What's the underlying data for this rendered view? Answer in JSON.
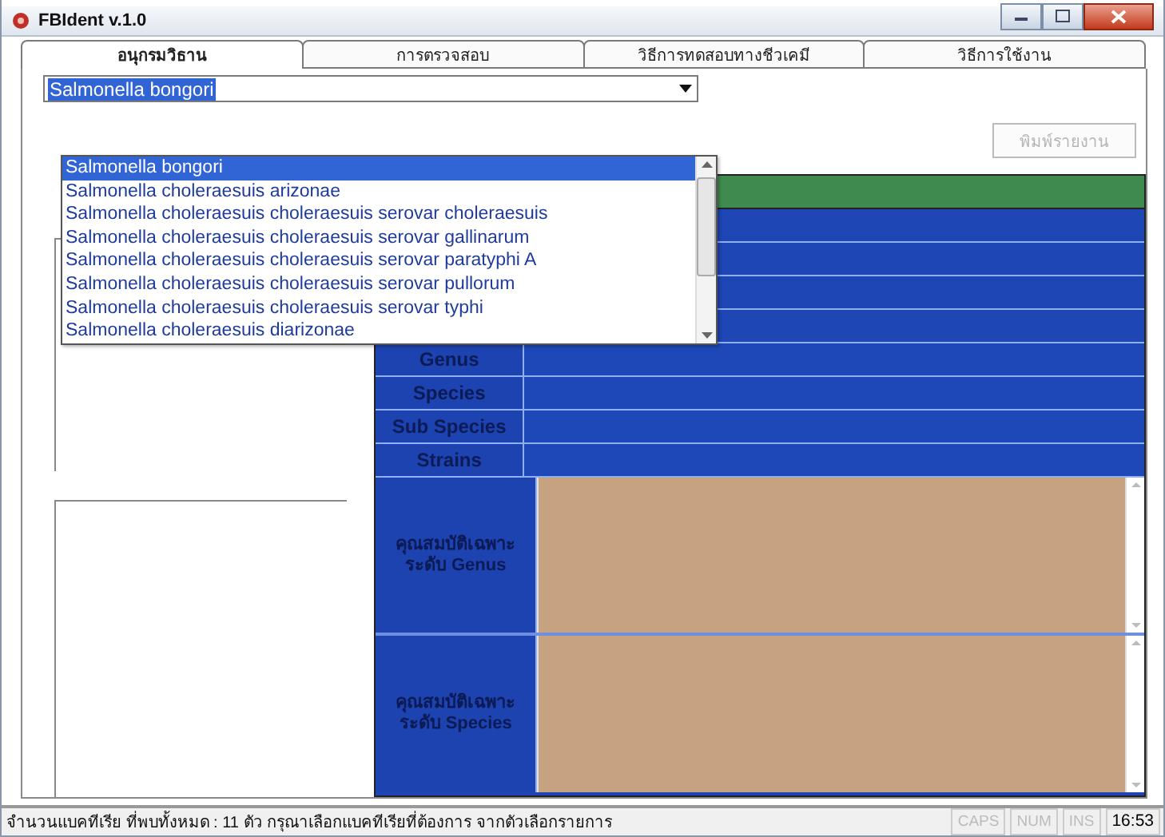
{
  "window": {
    "title": "FBIdent v.1.0"
  },
  "tabs": [
    {
      "label": "อนุกรมวิธาน",
      "selected": true
    },
    {
      "label": "การตรวจสอบ",
      "selected": false
    },
    {
      "label": "วิธีการทดสอบทางชีวเคมี",
      "selected": false
    },
    {
      "label": "วิธีการใช้งาน",
      "selected": false
    }
  ],
  "species_combo": {
    "value": "Salmonella bongori",
    "expanded": true
  },
  "dropdown_items": [
    {
      "label": "Salmonella bongori",
      "selected": true
    },
    {
      "label": "Salmonella choleraesuis arizonae",
      "selected": false
    },
    {
      "label": "Salmonella choleraesuis choleraesuis serovar choleraesuis",
      "selected": false
    },
    {
      "label": "Salmonella choleraesuis choleraesuis serovar gallinarum",
      "selected": false
    },
    {
      "label": "Salmonella choleraesuis choleraesuis serovar paratyphi A",
      "selected": false
    },
    {
      "label": "Salmonella choleraesuis choleraesuis serovar pullorum",
      "selected": false
    },
    {
      "label": "Salmonella choleraesuis choleraesuis serovar typhi",
      "selected": false
    },
    {
      "label": "Salmonella choleraesuis diarizonae",
      "selected": false
    }
  ],
  "print_button": {
    "label": "พิมพ์รายงาน",
    "disabled": true
  },
  "info_table": [
    {
      "kind": "header"
    },
    {
      "kind": "blank"
    },
    {
      "kind": "blank"
    },
    {
      "kind": "blank"
    },
    {
      "kind": "blank"
    },
    {
      "kind": "field",
      "label": "Genus"
    },
    {
      "kind": "field",
      "label": "Species"
    },
    {
      "kind": "field",
      "label": "Sub Species"
    },
    {
      "kind": "field",
      "label": "Strains"
    },
    {
      "kind": "text_area",
      "label": "คุณสมบัติเฉพาะ ระดับ Genus"
    },
    {
      "kind": "text_area",
      "label": "คุณสมบัติเฉพาะ ระดับ Species"
    }
  ],
  "status_bar": {
    "message": "จำนวนแบคทีเรีย ที่พบทั้งหมด : 11 ตัว  กรุณาเลือกแบคทีเรียที่ต้องการ จากตัวเลือกรายการ",
    "indicators": [
      {
        "label": "CAPS",
        "on": false
      },
      {
        "label": "NUM",
        "on": false
      },
      {
        "label": "INS",
        "on": false
      }
    ],
    "clock": "16:53"
  }
}
